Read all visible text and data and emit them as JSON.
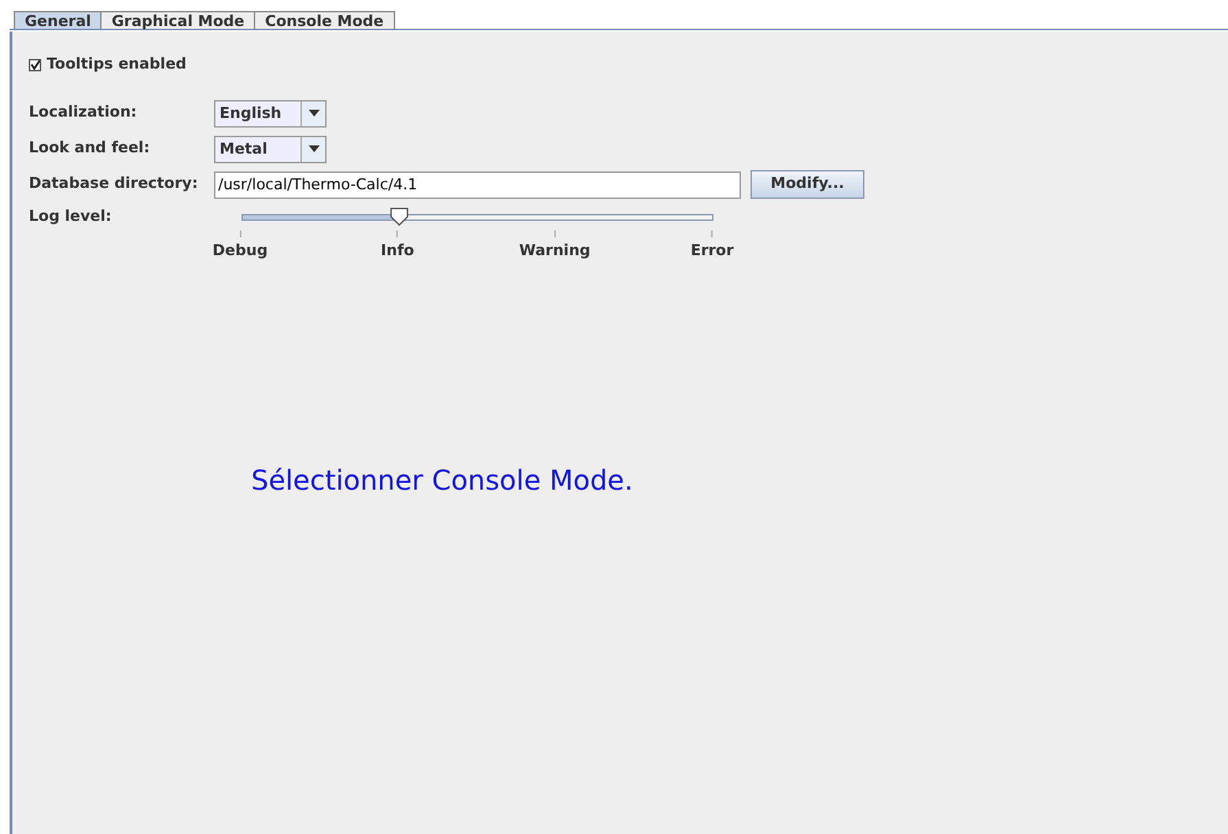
{
  "tabs": [
    {
      "label": "General",
      "selected": true
    },
    {
      "label": "Graphical Mode",
      "selected": false
    },
    {
      "label": "Console Mode",
      "selected": false
    }
  ],
  "tooltips": {
    "label": "Tooltips enabled",
    "checked": true
  },
  "localization": {
    "label": "Localization:",
    "value": "English"
  },
  "look_and_feel": {
    "label": "Look and feel:",
    "value": "Metal"
  },
  "database_directory": {
    "label": "Database directory:",
    "value": "/usr/local/Thermo-Calc/4.1",
    "button": "Modify..."
  },
  "log_level": {
    "label": "Log level:",
    "level": 0.3333,
    "ticks": [
      "Debug",
      "Info",
      "Warning",
      "Error"
    ]
  },
  "caption": "Sélectionner Console Mode."
}
